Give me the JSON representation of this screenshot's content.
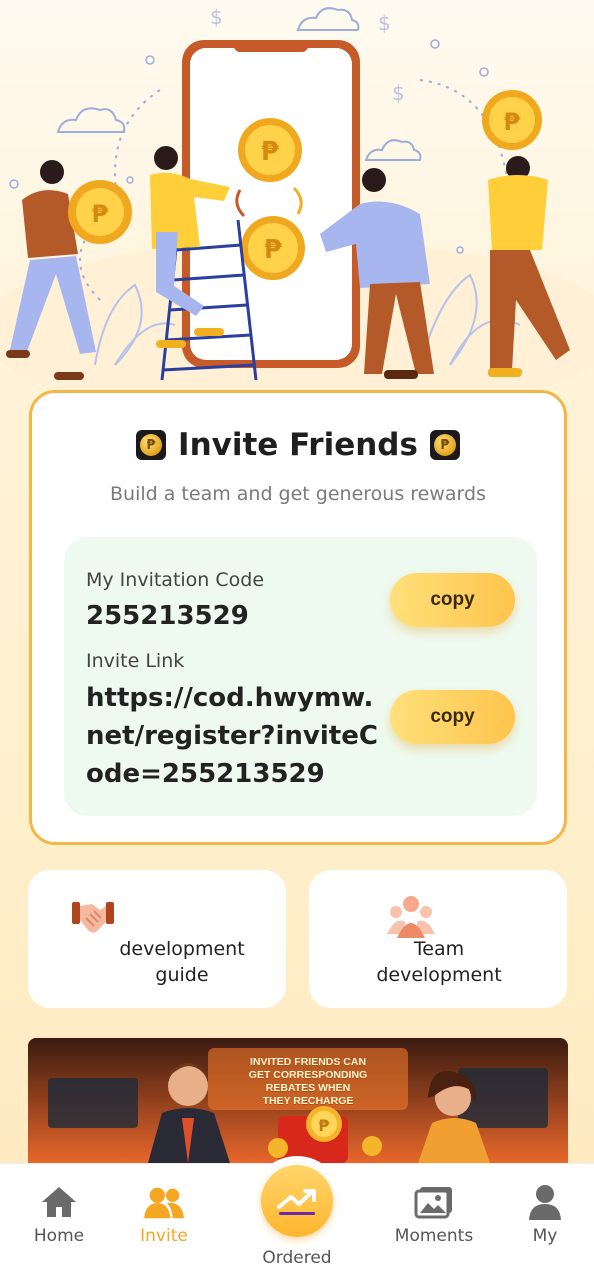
{
  "invite": {
    "title": "Invite Friends",
    "subtitle": "Build a team and get generous rewards",
    "code_label": "My Invitation Code",
    "code_value": "255213529",
    "link_label": "Invite Link",
    "link_value": "https://cod.hwymw.net/register?inviteCode=255213529",
    "copy_label": "copy",
    "coin_icon": "peso-coin-icon"
  },
  "quick": {
    "guide_label": "development\nguide",
    "team_label": "Team\ndevelopment"
  },
  "banner": {
    "text": "INVITED FRIENDS CAN\nGET CORRESPONDING\nREBATES WHEN\nTHEY RECHARGE"
  },
  "nav": {
    "home": "Home",
    "invite": "Invite",
    "ordered": "Ordered",
    "moments": "Moments",
    "my": "My"
  },
  "colors": {
    "accent": "#f5a623",
    "card_border": "#f5b646",
    "panel_bg": "#eefaf0"
  }
}
